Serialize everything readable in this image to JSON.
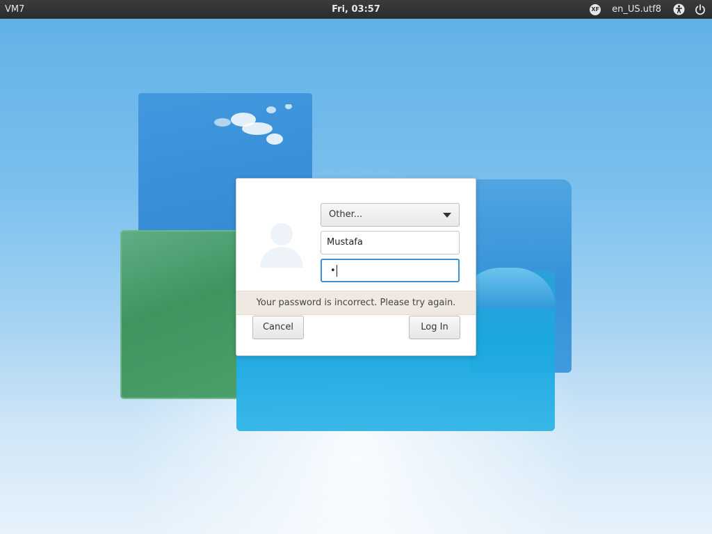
{
  "top_panel": {
    "hostname": "VM7",
    "clock": "Fri, 03:57",
    "keyboard_layout_badge": "XF",
    "locale": "en_US.utf8",
    "icons": [
      "xf-icon",
      "accessibility-icon",
      "power-icon"
    ]
  },
  "login": {
    "user_select_value": "Other...",
    "username_value": "Mustafa",
    "password_mask": "•",
    "error_message": "Your password is incorrect. Please try again.",
    "cancel_label": "Cancel",
    "login_label": "Log In"
  },
  "colors": {
    "panel_bg": "#2e2e2e",
    "focus_border": "#3d8fd6",
    "message_bar_bg": "#efe9e2"
  }
}
